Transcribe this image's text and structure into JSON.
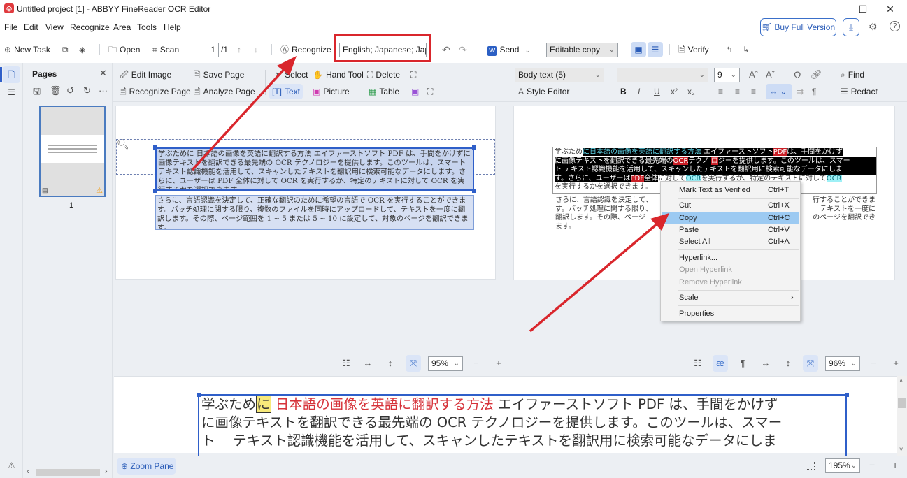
{
  "window": {
    "title": "Untitled project [1] - ABBYY FineReader OCR Editor",
    "app_icon": "abbyy-logo-icon",
    "controls": {
      "minimize": "–",
      "maximize": "☐",
      "close": "✕"
    }
  },
  "menu": [
    "File",
    "Edit",
    "View",
    "Recognize",
    "Area",
    "Tools",
    "Help"
  ],
  "header_right": {
    "buy_label": "Buy Full Version",
    "buy_icon": "cart-icon",
    "download_icon": "download-icon",
    "settings_icon": "gear-icon",
    "help_icon": "help-icon"
  },
  "main_toolbar": {
    "new_task": "New Task",
    "open": "Open",
    "scan": "Scan",
    "page_current": "1",
    "page_total": "/1",
    "recognize": "Recognize",
    "languages": "English; Japanese; Jap",
    "send": "Send",
    "output_mode": "Editable copy",
    "verify": "Verify"
  },
  "pages_panel": {
    "title": "Pages",
    "thumbnail_number": "1",
    "warning": "warning-icon"
  },
  "image_toolbar": {
    "edit_image": "Edit Image",
    "save_page": "Save Page",
    "recognize_page": "Recognize Page",
    "analyze_page": "Analyze Page",
    "select": "Select",
    "hand_tool": "Hand Tool",
    "delete": "Delete",
    "text": "Text",
    "picture": "Picture",
    "table": "Table"
  },
  "format_toolbar": {
    "style": "Body text (5)",
    "style_editor": "Style Editor",
    "font": "",
    "font_size": "9",
    "find": "Find",
    "redact": "Redact"
  },
  "image_pane": {
    "block1": "学ぶために 日本語の画像を英語に翻訳する方法 エイファーストソフト PDF は、手間をかけずに画像テキストを翻訳できる最先端の OCR テクノロジーを提供します。このツールは、スマート テキスト認識機能を活用して、スキャンしたテキストを翻訳用に検索可能なデータにします。さらに、ユーザーは PDF 全体に対して OCR を実行するか、特定のテキストに対して OCR を実行するかを選択できます。",
    "block1_title": "日本語の画像を英語に翻訳する方法",
    "block2": "さらに、言語認識を決定して、正確な翻訳のために希望の言語で OCR を実行することができます。バッチ処理に関する限り、複数のファイルを同時にアップロードして、テキストを一度に翻訳します。その際、ページ範囲を 1 ~ 5 または 5 ~ 10 に設定して、対象のページを翻訳できます。",
    "zoom": "95%"
  },
  "text_pane": {
    "lines": [
      [
        "学ぶため",
        "に日本語の画像を英語に翻訳する方法",
        " エイファーストソフト",
        "PDF",
        "は、手間をかけず"
      ],
      [
        "に画像テキストを翻訳できる最先端の",
        "OCR",
        "テクノ",
        "ロ",
        "ジーを提供します。このツールは、スマー"
      ],
      [
        "ト テキスト認識機能を活用して、スキャンしたテキストを翻訳用に検索可能なデータにしま"
      ],
      [
        "す。さらに、ユーザーは",
        "PDF",
        "全体",
        "に対して",
        "OCR",
        "を実行するか、特定のテキストに対して",
        "OCR"
      ],
      [
        "を実行するかを選択できます。"
      ]
    ],
    "para2_left": [
      "さらに、言語認識を決定して、",
      "す。バッチ処理に関する限り、",
      "翻訳します。その際、ページ",
      "ます。"
    ],
    "para2_right": [
      "行することができま",
      "テキストを一度に",
      "のページを翻訳でき"
    ],
    "zoom": "96%"
  },
  "context_menu": {
    "items": [
      {
        "label": "Mark Text as Verified",
        "shortcut": "Ctrl+T"
      },
      {
        "label": "Cut",
        "shortcut": "Ctrl+X"
      },
      {
        "label": "Copy",
        "shortcut": "Ctrl+C",
        "highlighted": true
      },
      {
        "label": "Paste",
        "shortcut": "Ctrl+V"
      },
      {
        "label": "Select All",
        "shortcut": "Ctrl+A"
      },
      {
        "label": "Hyperlink..."
      },
      {
        "label": "Open Hyperlink",
        "disabled": true
      },
      {
        "label": "Remove Hyperlink",
        "disabled": true
      },
      {
        "label": "Scale",
        "submenu": "›"
      },
      {
        "label": "Properties"
      }
    ]
  },
  "zoom_pane": {
    "line1_pre": "学ぶため",
    "line1_marker": "に",
    "line1_title": "日本語の画像を英語に翻訳する方法",
    "line1_post": "エイファーストソフト PDF は、手間をかけず",
    "line2": "に画像テキストを翻訳できる最先端の OCR テクノロジーを提供します。このツールは、スマー",
    "line3": "ト　 テキスト認識機能を活用して、スキャンしたテキストを翻訳用に検索可能なデータにしま",
    "zoom": "195%",
    "button": "Zoom Pane"
  },
  "colors": {
    "accent": "#2f5fc9",
    "annotation_red": "#d9262c",
    "menu_highlight": "#9ccaf2"
  }
}
